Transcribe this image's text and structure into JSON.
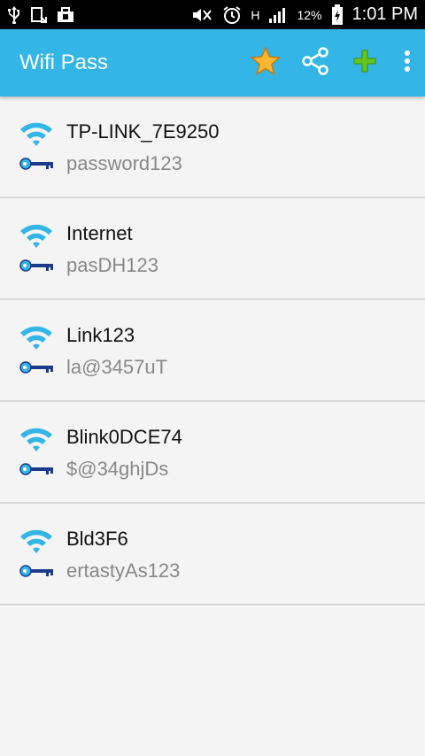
{
  "status_bar": {
    "battery": "12%",
    "time": "1:01 PM",
    "network": "H",
    "icons": [
      "usb-icon",
      "download-icon",
      "bag-icon",
      "mute-icon",
      "alarm-icon",
      "hspa-icon",
      "signal-icon",
      "battery-icon"
    ]
  },
  "app_bar": {
    "title": "Wifi Pass",
    "actions": [
      "star-icon",
      "share-icon",
      "add-icon",
      "overflow-menu-icon"
    ],
    "accent": "#33b5e5"
  },
  "networks": [
    {
      "ssid": "TP-LINK_7E9250",
      "password": "password123"
    },
    {
      "ssid": "Internet",
      "password": "pasDH123"
    },
    {
      "ssid": "Link123",
      "password": "la@3457uT"
    },
    {
      "ssid": "Blink0DCE74",
      "password": "$@34ghjDs"
    },
    {
      "ssid": "Bld3F6",
      "password": "ertastyAs123"
    }
  ]
}
